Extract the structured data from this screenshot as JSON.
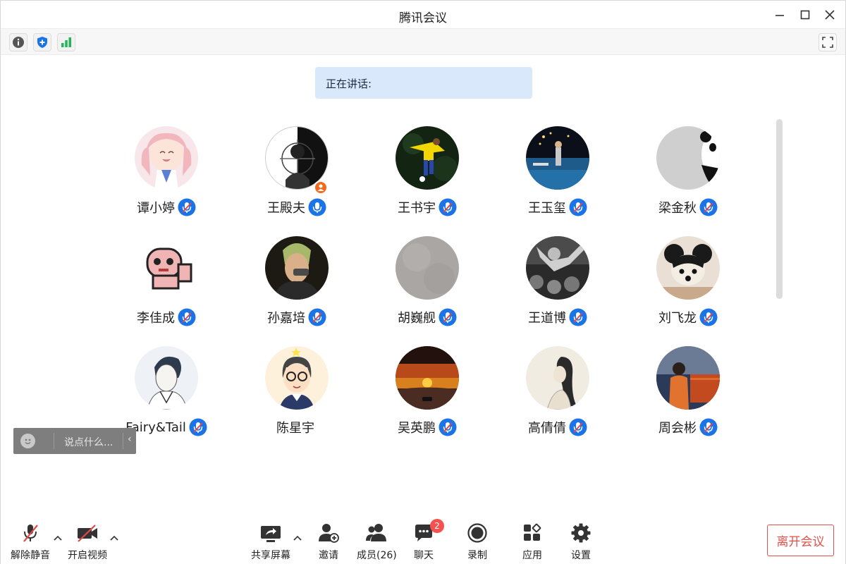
{
  "window": {
    "title": "腾讯会议"
  },
  "speaking": {
    "label": "正在讲话:"
  },
  "participants": [
    {
      "name": "谭小婷",
      "mic": "muted"
    },
    {
      "name": "王殿夫",
      "mic": "on",
      "host": true
    },
    {
      "name": "王书宇",
      "mic": "muted"
    },
    {
      "name": "王玉玺",
      "mic": "muted"
    },
    {
      "name": "梁金秋",
      "mic": "muted"
    },
    {
      "name": "李佳成",
      "mic": "muted"
    },
    {
      "name": "孙嘉培",
      "mic": "muted"
    },
    {
      "name": "胡巍舰",
      "mic": "muted"
    },
    {
      "name": "王道博",
      "mic": "muted"
    },
    {
      "name": "刘飞龙",
      "mic": "muted"
    },
    {
      "name": "Fairy&Tail",
      "mic": "muted"
    },
    {
      "name": "陈星宇",
      "mic": "none"
    },
    {
      "name": "吴英鹏",
      "mic": "muted"
    },
    {
      "name": "高倩倩",
      "mic": "muted"
    },
    {
      "name": "周会彬",
      "mic": "muted"
    }
  ],
  "chat": {
    "placeholder": "说点什么..."
  },
  "controls": {
    "unmute": "解除静音",
    "start_video": "开启视频",
    "share_screen": "共享屏幕",
    "invite": "邀请",
    "members": "成员(26)",
    "chat": "聊天",
    "chat_badge": "2",
    "record": "录制",
    "apps": "应用",
    "settings": "设置",
    "leave": "离开会议"
  },
  "colors": {
    "accent": "#1a73e8",
    "danger": "#e3504a",
    "banner": "#d9e8fb"
  }
}
